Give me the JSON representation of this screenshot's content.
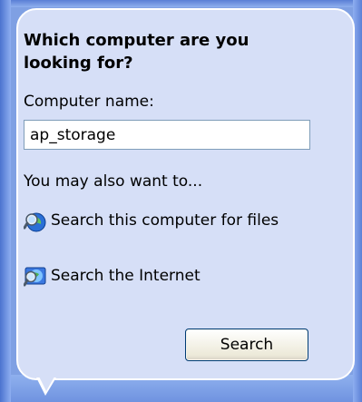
{
  "balloon": {
    "title": "Which computer are you looking for?",
    "field_label": "Computer name:",
    "field_value": "ap_storage",
    "hint": "You may also want to...",
    "options": [
      {
        "label": "Search this computer for files",
        "icon": "search-computer-icon"
      },
      {
        "label": "Search the Internet",
        "icon": "search-internet-icon"
      }
    ],
    "search_button": "Search"
  },
  "colors": {
    "balloon_bg": "#d6dff7",
    "frame_blue": "#7fa0e3",
    "button_border": "#003c74"
  }
}
